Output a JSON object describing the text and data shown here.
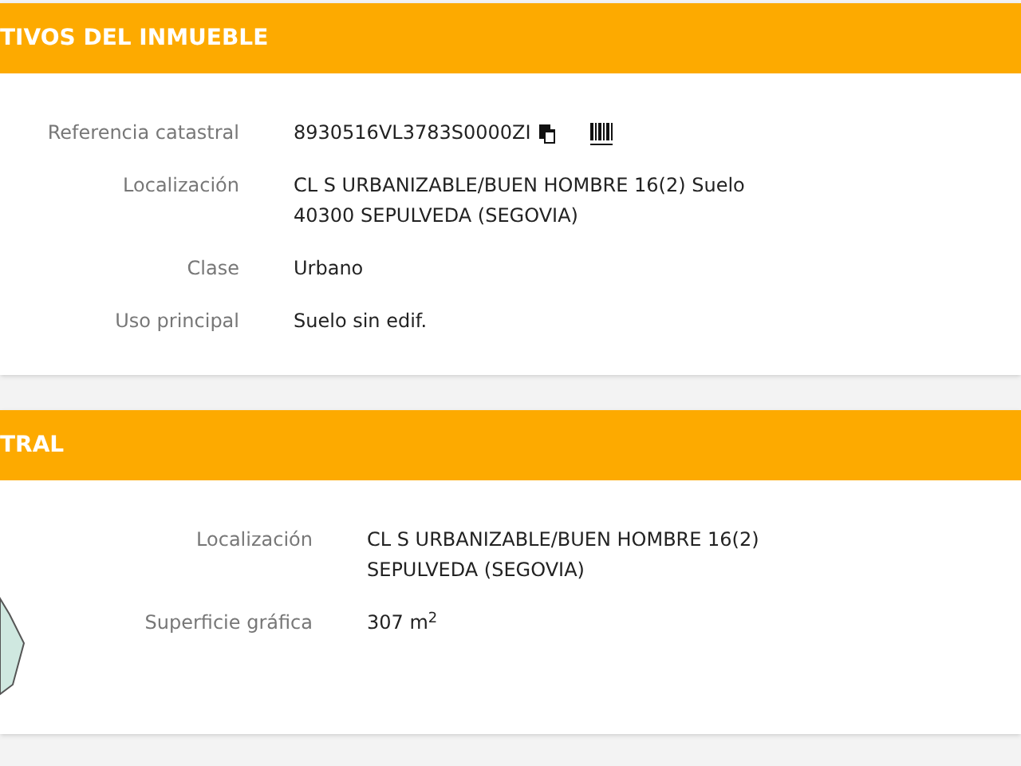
{
  "sections": [
    {
      "title": "TIVOS DEL INMUEBLE",
      "has_parcel": false,
      "rows": [
        {
          "label": "Referencia catastral",
          "lines": [
            "8930516VL3783S0000ZI"
          ],
          "actions": true
        },
        {
          "label": "Localización",
          "lines": [
            "CL S URBANIZABLE/BUEN HOMBRE 16(2) Suelo",
            "40300 SEPULVEDA (SEGOVIA)"
          ],
          "actions": false
        },
        {
          "label": "Clase",
          "lines": [
            "Urbano"
          ],
          "actions": false
        },
        {
          "label": "Uso principal",
          "lines": [
            "Suelo sin edif."
          ],
          "actions": false
        }
      ]
    },
    {
      "title": "TRAL",
      "has_parcel": true,
      "rows": [
        {
          "label": "Localización",
          "lines": [
            "CL S URBANIZABLE/BUEN HOMBRE 16(2)",
            "SEPULVEDA (SEGOVIA)"
          ],
          "actions": false
        },
        {
          "label": "Superficie gráfica",
          "lines": [
            "307 m$^{2}$"
          ],
          "actions": false
        }
      ]
    }
  ]
}
